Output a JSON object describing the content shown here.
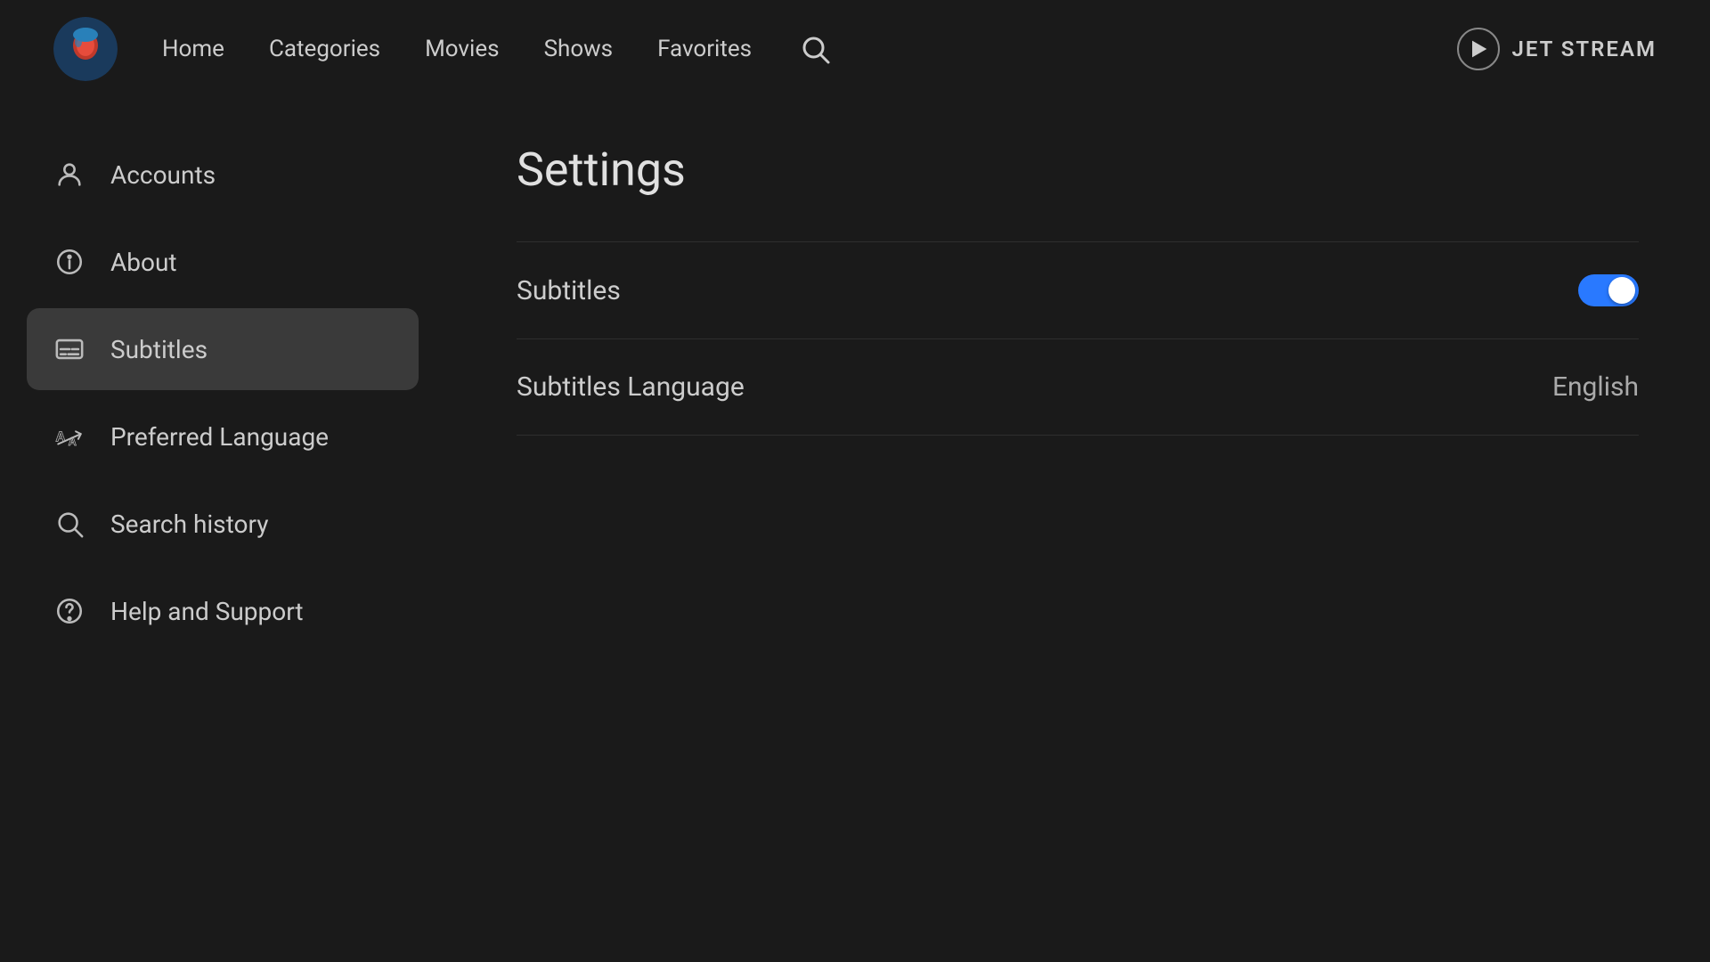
{
  "nav": {
    "links": [
      {
        "label": "Home",
        "id": "home"
      },
      {
        "label": "Categories",
        "id": "categories"
      },
      {
        "label": "Movies",
        "id": "movies"
      },
      {
        "label": "Shows",
        "id": "shows"
      },
      {
        "label": "Favorites",
        "id": "favorites"
      }
    ],
    "brand_name": "JET STREAM"
  },
  "sidebar": {
    "items": [
      {
        "id": "accounts",
        "label": "Accounts",
        "icon": "person-icon",
        "active": false
      },
      {
        "id": "about",
        "label": "About",
        "icon": "info-icon",
        "active": false
      },
      {
        "id": "subtitles",
        "label": "Subtitles",
        "icon": "subtitles-icon",
        "active": true
      },
      {
        "id": "preferred-language",
        "label": "Preferred Language",
        "icon": "language-icon",
        "active": false
      },
      {
        "id": "search-history",
        "label": "Search history",
        "icon": "search-icon",
        "active": false
      },
      {
        "id": "help-support",
        "label": "Help and Support",
        "icon": "help-icon",
        "active": false
      }
    ]
  },
  "settings": {
    "title": "Settings",
    "rows": [
      {
        "id": "subtitles-toggle",
        "label": "Subtitles",
        "type": "toggle",
        "value": true
      },
      {
        "id": "subtitles-language",
        "label": "Subtitles Language",
        "type": "value",
        "value": "English"
      }
    ]
  },
  "colors": {
    "toggle_active": "#2979ff",
    "active_bg": "#3a3a3a"
  }
}
